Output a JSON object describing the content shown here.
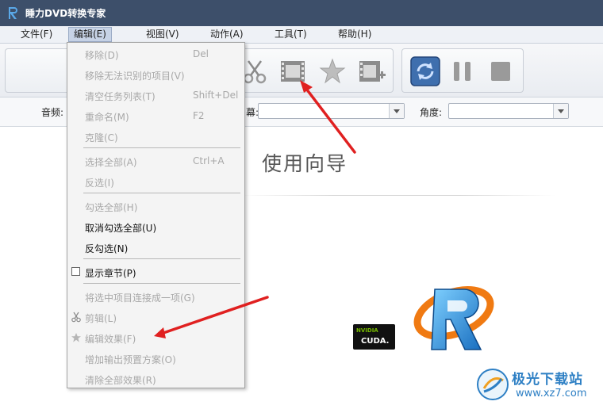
{
  "window": {
    "title": "睡力DVD转换专家"
  },
  "menubar": {
    "items": [
      {
        "label": "文件(F)"
      },
      {
        "label": "编辑(E)"
      },
      {
        "label": "视图(V)"
      },
      {
        "label": "动作(A)"
      },
      {
        "label": "工具(T)"
      },
      {
        "label": "帮助(H)"
      }
    ]
  },
  "toolbar": {
    "icons": [
      "scissors-icon",
      "film-icon",
      "star-icon",
      "film-add-icon",
      "convert-icon",
      "pause-icon",
      "stop-icon"
    ]
  },
  "options": {
    "audio_label": "音频:",
    "subtitle_label_tail": "幕:",
    "angle_label": "角度:"
  },
  "main": {
    "wizard_title": "使用向导"
  },
  "badge": {
    "brand": "NVIDIA",
    "product": "CUDA."
  },
  "edit_menu": {
    "items": [
      {
        "label": "移除(D)",
        "shortcut": "Del",
        "enabled": false
      },
      {
        "label": "移除无法识别的项目(V)",
        "shortcut": "",
        "enabled": false
      },
      {
        "label": "清空任务列表(T)",
        "shortcut": "Shift+Del",
        "enabled": false
      },
      {
        "label": "重命名(M)",
        "shortcut": "F2",
        "enabled": false
      },
      {
        "label": "克隆(C)",
        "shortcut": "",
        "enabled": false
      },
      {
        "label": "选择全部(A)",
        "shortcut": "Ctrl+A",
        "enabled": false
      },
      {
        "label": "反选(I)",
        "shortcut": "",
        "enabled": false
      },
      {
        "label": "勾选全部(H)",
        "shortcut": "",
        "enabled": false
      },
      {
        "label": "取消勾选全部(U)",
        "shortcut": "",
        "enabled": true
      },
      {
        "label": "反勾选(N)",
        "shortcut": "",
        "enabled": true
      },
      {
        "label": "显示章节(P)",
        "shortcut": "",
        "enabled": true
      },
      {
        "label": "将选中项目连接成一项(G)",
        "shortcut": "",
        "enabled": false
      },
      {
        "label": "剪辑(L)",
        "shortcut": "",
        "enabled": false
      },
      {
        "label": "编辑效果(F)",
        "shortcut": "",
        "enabled": false
      },
      {
        "label": "增加输出预置方案(O)",
        "shortcut": "",
        "enabled": false
      },
      {
        "label": "清除全部效果(R)",
        "shortcut": "",
        "enabled": false
      }
    ]
  },
  "watermark": {
    "name": "极光下载站",
    "url": "www.xz7.com"
  },
  "colors": {
    "titlebar": "#3d4f6a",
    "accent": "#2d7fc4",
    "arrow": "#e02020",
    "disabled": "#a8a8a8"
  }
}
